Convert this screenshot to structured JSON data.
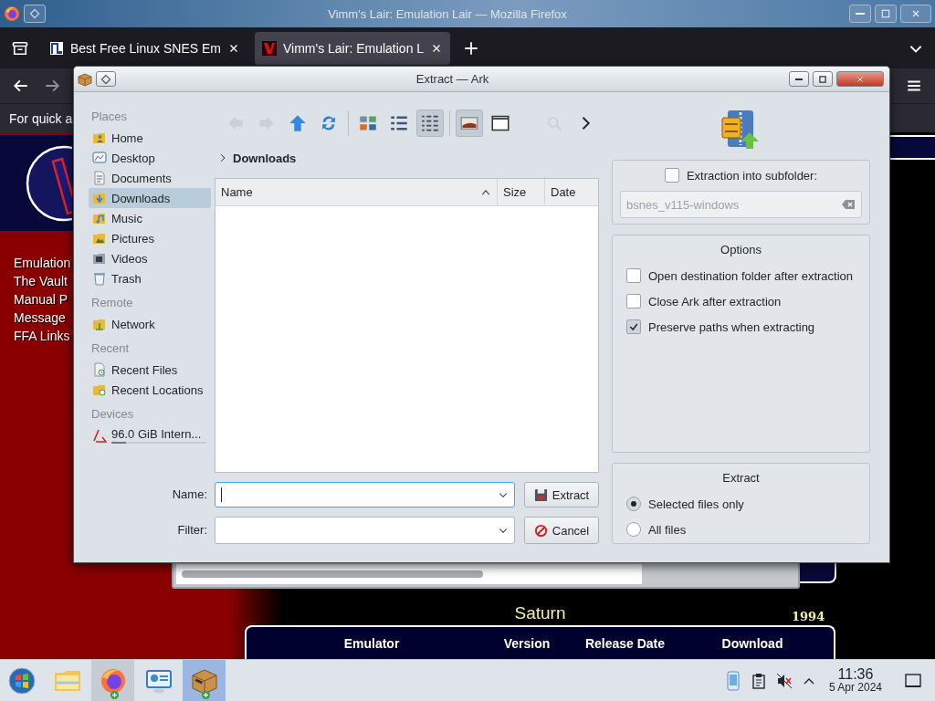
{
  "browser": {
    "title": "Vimm's Lair: Emulation Lair — Mozilla Firefox",
    "tabs": [
      {
        "title": "Best Free Linux SNES Em",
        "selected": false
      },
      {
        "title": "Vimm's Lair: Emulation L",
        "selected": true
      }
    ],
    "notice": "For quick a",
    "page": {
      "nav_links": [
        "Emulation",
        "The Vault",
        "Manual P",
        "Message",
        "FFA Links"
      ],
      "section": {
        "title": "Saturn",
        "year": "1994",
        "columns": [
          "Emulator",
          "Version",
          "Release Date",
          "Download"
        ]
      }
    }
  },
  "dialog": {
    "title": "Extract — Ark",
    "toolbar": [
      {
        "kind": "back",
        "disabled": true,
        "selected": false
      },
      {
        "kind": "forward",
        "disabled": true,
        "selected": false
      },
      {
        "kind": "up",
        "disabled": false,
        "selected": false
      },
      {
        "kind": "reload",
        "disabled": false,
        "selected": false
      },
      {
        "kind": "icons",
        "disabled": false,
        "selected": false
      },
      {
        "kind": "compact",
        "disabled": false,
        "selected": false
      },
      {
        "kind": "detailed",
        "disabled": false,
        "selected": true
      },
      {
        "kind": "preview",
        "disabled": false,
        "selected": true
      },
      {
        "kind": "panel",
        "disabled": false,
        "selected": false
      },
      {
        "kind": "zoom",
        "disabled": true,
        "selected": false
      },
      {
        "kind": "more",
        "disabled": false,
        "selected": false
      }
    ],
    "places": [
      {
        "heading": "Places",
        "items": [
          {
            "label": "Home",
            "kind": "home",
            "selected": false
          },
          {
            "label": "Desktop",
            "kind": "desktop",
            "selected": false
          },
          {
            "label": "Documents",
            "kind": "documents",
            "selected": false
          },
          {
            "label": "Downloads",
            "kind": "downloads",
            "selected": true
          },
          {
            "label": "Music",
            "kind": "music",
            "selected": false
          },
          {
            "label": "Pictures",
            "kind": "pictures",
            "selected": false
          },
          {
            "label": "Videos",
            "kind": "videos",
            "selected": false
          },
          {
            "label": "Trash",
            "kind": "trash",
            "selected": false
          }
        ]
      },
      {
        "heading": "Remote",
        "items": [
          {
            "label": "Network",
            "kind": "network",
            "selected": false
          }
        ]
      },
      {
        "heading": "Recent",
        "items": [
          {
            "label": "Recent Files",
            "kind": "recent-files",
            "selected": false
          },
          {
            "label": "Recent Locations",
            "kind": "recent-locations",
            "selected": false
          }
        ]
      },
      {
        "heading": "Devices",
        "items": [
          {
            "label": "96.0 GiB Intern...",
            "kind": "device",
            "selected": false,
            "level": 0.15
          }
        ]
      }
    ],
    "breadcrumb": "Downloads",
    "columns": [
      {
        "label": "Name",
        "sorted": true
      },
      {
        "label": "Size",
        "sorted": false
      },
      {
        "label": "Date",
        "sorted": false
      }
    ],
    "name_label": "Name:",
    "filter_label": "Filter:",
    "buttons": [
      {
        "label": "Extract",
        "kind": "extract"
      },
      {
        "label": "Cancel",
        "kind": "cancel"
      }
    ],
    "subfolder": {
      "label": "Extraction into subfolder:",
      "checked": false,
      "value": "bsnes_v115-windows",
      "disabled": true
    },
    "options": {
      "title": "Options",
      "items": [
        {
          "label": "Open destination folder after extraction",
          "checked": false
        },
        {
          "label": "Close Ark after extraction",
          "checked": false
        },
        {
          "label": "Preserve paths when extracting",
          "checked": true
        }
      ]
    },
    "extract": {
      "title": "Extract",
      "choices": [
        {
          "label": "Selected files only",
          "selected": true
        },
        {
          "label": "All files",
          "selected": false
        }
      ]
    }
  },
  "taskbar": {
    "apps": [
      {
        "kind": "start",
        "open": false,
        "active": false
      },
      {
        "kind": "files",
        "open": false,
        "active": false
      },
      {
        "kind": "browser",
        "open": true,
        "active": false
      },
      {
        "kind": "settings",
        "open": false,
        "active": false
      },
      {
        "kind": "archiver",
        "open": true,
        "active": true
      }
    ],
    "volume_muted": true,
    "time": "11:36",
    "date": "5 Apr 2024"
  }
}
